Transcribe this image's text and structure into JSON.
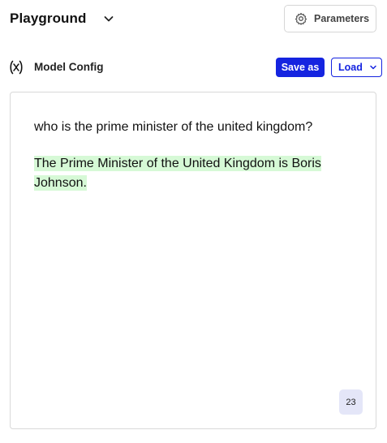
{
  "header": {
    "title": "Playground",
    "chevron_icon": "chevron-down-icon",
    "parameters_label": "Parameters",
    "parameters_icon": "gear-icon"
  },
  "config": {
    "icon": "variable-icon",
    "label": "Model Config",
    "save_label": "Save as",
    "load_label": "Load",
    "load_icon": "chevron-down-icon",
    "accent_color": "#1524e0"
  },
  "editor": {
    "prompt": "who is the prime minister of the united kingdom?",
    "completion": "The Prime Minister of the United Kingdom is Boris Johnson.",
    "completion_highlight_color": "#d6f9d6",
    "token_count": "23"
  }
}
